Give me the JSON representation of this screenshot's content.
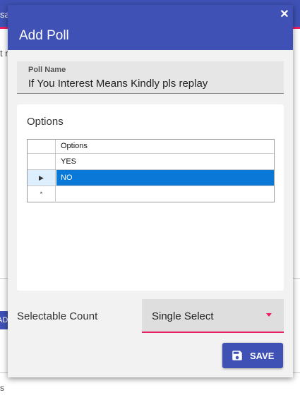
{
  "background": {
    "topbar_fragment": "sa",
    "side_fragment": "t r",
    "button_fragment": "AD",
    "bottom_fragment": "s"
  },
  "dialog": {
    "title": "Add Poll",
    "close_glyph": "✕"
  },
  "poll_name": {
    "label": "Poll Name",
    "value": "If You Interest Means Kindly pls replay"
  },
  "options": {
    "title": "Options",
    "column_header": "Options",
    "rows": [
      {
        "indicator": "",
        "value": "YES",
        "selected": false
      },
      {
        "indicator": "▶",
        "value": "NO",
        "selected": true
      },
      {
        "indicator": "*",
        "value": "",
        "selected": false
      }
    ]
  },
  "selectable_count": {
    "label": "Selectable Count",
    "value": "Single Select"
  },
  "save_button": {
    "label": "SAVE",
    "icon": "floppy-disk-icon"
  },
  "colors": {
    "primary": "#3f51b5",
    "accent": "#e91e63",
    "selection": "#0a78d7"
  }
}
